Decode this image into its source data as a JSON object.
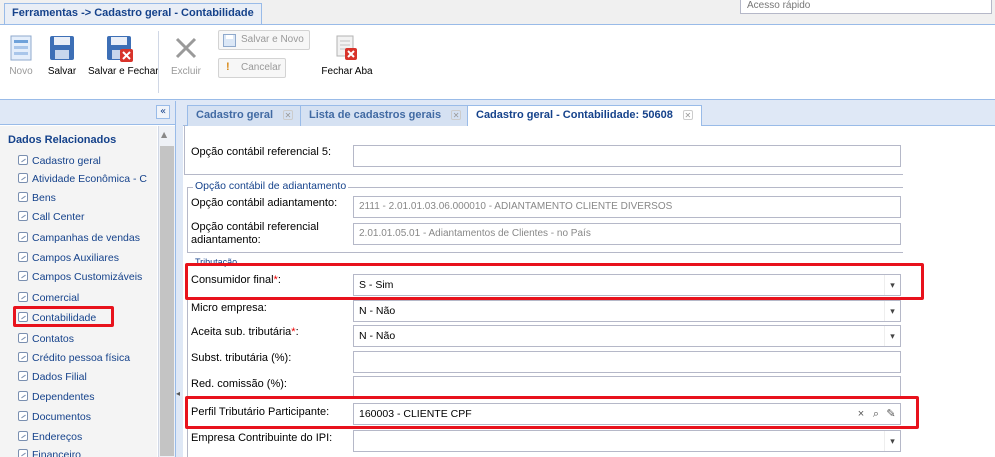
{
  "window": {
    "tab_title": "Ferramentas -> Cadastro geral - Contabilidade",
    "quick_access": "Acesso rápido"
  },
  "toolbar": {
    "new": "Novo",
    "save": "Salvar",
    "save_close": "Salvar e Fechar",
    "delete": "Excluir",
    "save_new": "Salvar e Novo",
    "cancel": "Cancelar",
    "close_tab": "Fechar Aba"
  },
  "sidebar": {
    "collapse": "«",
    "title": "Dados Relacionados",
    "items": [
      "Cadastro geral",
      "Atividade Econômica - C",
      "Bens",
      "Call Center",
      "Campanhas de vendas",
      "Campos Auxiliares",
      "Campos Customizáveis",
      "Comercial",
      "Contabilidade",
      "Contatos",
      "Crédito pessoa física",
      "Dados Filial",
      "Dependentes",
      "Documentos",
      "Endereços",
      "Financeiro"
    ]
  },
  "tabs": [
    {
      "label": "Cadastro geral"
    },
    {
      "label": "Lista de cadastros gerais"
    },
    {
      "label": "Cadastro geral - Contabilidade: 50608"
    }
  ],
  "tab_close": "✕",
  "form": {
    "opcao_ref5_label": "Opção contábil referencial 5:",
    "adiantamento_legend": "Opção contábil de adiantamento",
    "adiantamento_label": "Opção contábil adiantamento:",
    "adiantamento_value": "2111 - 2.01.01.03.06.000010 - ADIANTAMENTO CLIENTE DIVERSOS",
    "ref_adiant_label": "Opção contábil referencial adiantamento:",
    "ref_adiant_value": "2.01.01.05.01 - Adiantamentos de Clientes - no País",
    "tributacao_legend": "Tributação",
    "consumidor_label": "Consumidor final",
    "consumidor_value": "S - Sim",
    "micro_label": "Micro empresa:",
    "micro_value": "N - Não",
    "aceita_label": "Aceita sub. tributária",
    "aceita_value": "N - Não",
    "subst_label": "Subst. tributária (%):",
    "red_label": "Red. comissão (%):",
    "perfil_label": "Perfil Tributário Participante:",
    "perfil_value": "160003 - CLIENTE CPF",
    "ipi_label": "Empresa Contribuinte do IPI:",
    "req": "*",
    "colon": ":"
  },
  "colors": {
    "highlight": "#e8121c",
    "accent": "#15428b",
    "border": "#99bbe8"
  }
}
